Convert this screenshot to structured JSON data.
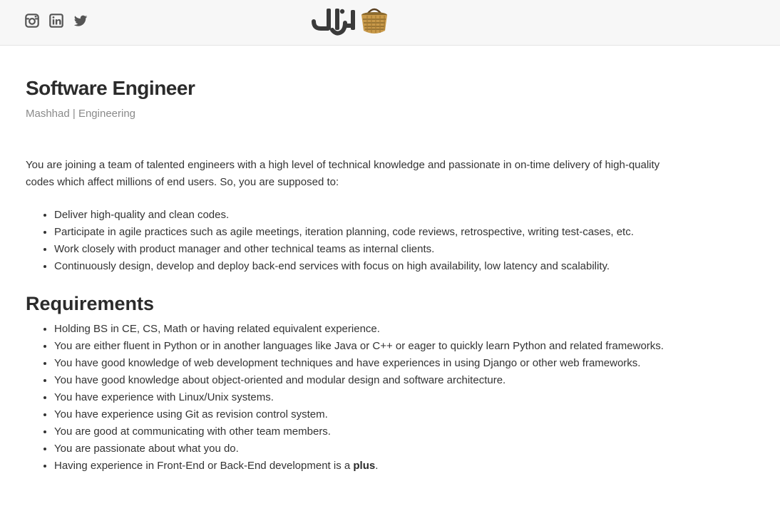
{
  "header": {
    "social": [
      {
        "name": "instagram-icon",
        "color": "#555555"
      },
      {
        "name": "linkedin-icon",
        "color": "#555555"
      },
      {
        "name": "twitter-icon",
        "color": "#555555"
      }
    ],
    "logo": "bazaar-logo-icon"
  },
  "job": {
    "title": "Software Engineer",
    "location": "Mashhad",
    "separator": " | ",
    "team": "Engineering",
    "intro": "You are joining a team of talented engineers with a high level of technical knowledge and passionate in on-time delivery of high-quality codes which affect millions of end users. So, you are supposed to:",
    "duties": [
      "Deliver high-quality and clean codes.",
      "Participate in agile practices such as agile meetings, iteration planning, code reviews, retrospective, writing test-cases, etc.",
      "Work closely with product manager and other technical teams as internal clients.",
      "Continuously design, develop and deploy back-end services with focus on high availability, low latency and scalability."
    ],
    "requirements_heading": "Requirements",
    "requirements": [
      "Holding BS in CE, CS, Math or having related equivalent experience.",
      "You are either fluent in Python or in another languages like Java or C++ or eager to quickly learn Python and related frameworks.",
      "You have good knowledge of web development techniques and have experiences in using Django or other web frameworks.",
      "You have good knowledge about object-oriented and modular design and software architecture.",
      "You have experience with Linux/Unix systems.",
      "You have experience using Git as revision control system.",
      "You are good at communicating with other team members.",
      "You are passionate about what you do."
    ],
    "last_requirement_prefix": "Having experience in Front-End or Back-End development is a ",
    "last_requirement_bold": "plus",
    "last_requirement_suffix": "."
  }
}
